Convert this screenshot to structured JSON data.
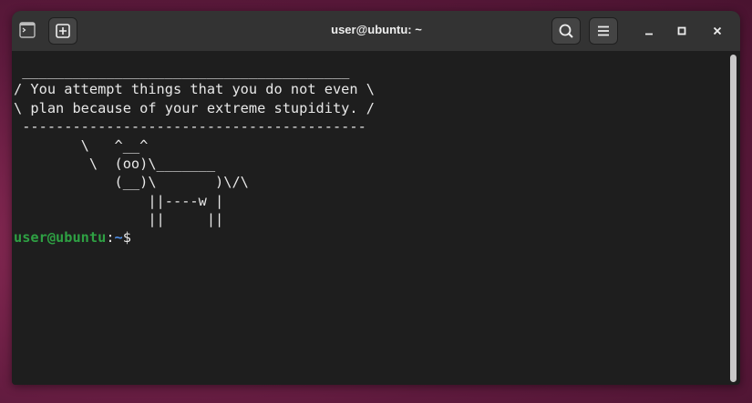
{
  "window": {
    "title": "user@ubuntu: ~"
  },
  "terminal": {
    "output_lines": [
      " _______________________________________",
      "/ You attempt things that you do not even \\",
      "\\ plan because of your extreme stupidity. /",
      " -----------------------------------------",
      "        \\   ^__^",
      "         \\  (oo)\\_______",
      "            (__)\\       )\\/\\",
      "                ||----w |",
      "                ||     ||"
    ],
    "prompt": {
      "user_host": "user@ubuntu",
      "colon": ":",
      "path": "~",
      "symbol": "$"
    }
  },
  "colors": {
    "prompt_user": "#2ea043",
    "prompt_path": "#4f8fe6",
    "terminal_bg": "#1e1e1e",
    "titlebar_bg": "#333333"
  },
  "icons": {
    "tab": "terminal-icon",
    "new_tab": "plus-square-icon",
    "search": "search-icon",
    "menu": "hamburger-menu-icon",
    "minimize": "minimize-icon",
    "maximize": "maximize-icon",
    "close": "close-icon"
  }
}
